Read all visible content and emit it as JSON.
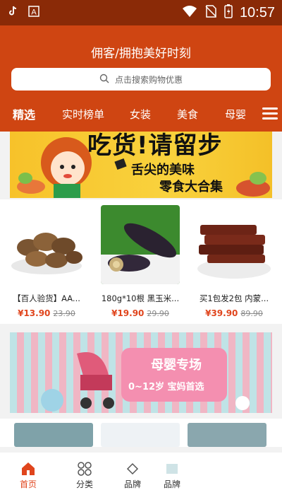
{
  "statusbar": {
    "time": "10:57",
    "icons": [
      "tiktok-icon",
      "a-icon",
      "wifi-icon",
      "no-sim-icon",
      "battery-icon"
    ]
  },
  "header": {
    "title": "佣客/拥抱美好时刻",
    "search_placeholder": "点击搜索购物优惠"
  },
  "tabs": [
    {
      "label": "精选",
      "active": true
    },
    {
      "label": "实时榜单"
    },
    {
      "label": "女装"
    },
    {
      "label": "美食"
    },
    {
      "label": "母婴"
    }
  ],
  "banner1": {
    "title": "吃货!请留步",
    "line1": "舌尖的美味",
    "line2": "零食大合集"
  },
  "products": [
    {
      "name": "【百人验货】AA...",
      "price": "¥13.90",
      "old_price": "23.90"
    },
    {
      "name": "180g*10根 黑玉米...",
      "price": "¥19.90",
      "old_price": "29.90"
    },
    {
      "name": "买1包发2包 内蒙...",
      "price": "¥39.90",
      "old_price": "89.90"
    }
  ],
  "banner2": {
    "title": "母婴专场",
    "subtitle": "0~12岁 宝妈首选"
  },
  "bottom_nav": [
    {
      "label": "首页",
      "active": true
    },
    {
      "label": "分类"
    },
    {
      "label": "品牌"
    },
    {
      "label": "品牌"
    }
  ],
  "colors": {
    "header": "#cf4512",
    "statusbar": "#8a2a07",
    "accent": "#e0451d"
  }
}
